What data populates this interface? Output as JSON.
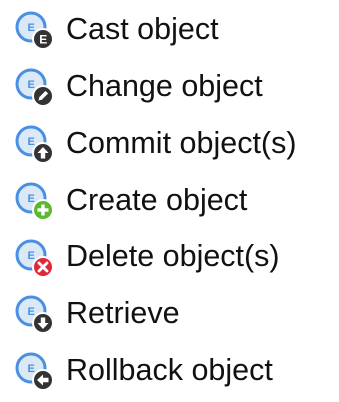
{
  "actions": [
    {
      "label": "Cast object",
      "icon": "cast-icon",
      "badge": "E",
      "badge_color": "#333333"
    },
    {
      "label": "Change object",
      "icon": "change-icon",
      "badge": "pencil",
      "badge_color": "#333333"
    },
    {
      "label": "Commit object(s)",
      "icon": "commit-icon",
      "badge": "arrow-up",
      "badge_color": "#333333"
    },
    {
      "label": "Create object",
      "icon": "create-icon",
      "badge": "plus",
      "badge_color": "#5cb82e"
    },
    {
      "label": "Delete object(s)",
      "icon": "delete-icon",
      "badge": "x",
      "badge_color": "#e0283a"
    },
    {
      "label": "Retrieve",
      "icon": "retrieve-icon",
      "badge": "arrow-down",
      "badge_color": "#333333"
    },
    {
      "label": "Rollback object",
      "icon": "rollback-icon",
      "badge": "arrow-left",
      "badge_color": "#333333"
    }
  ],
  "colors": {
    "entity_circle": "#dbe9f7",
    "entity_stroke": "#4a90e2",
    "entity_letter": "#4a90e2"
  }
}
